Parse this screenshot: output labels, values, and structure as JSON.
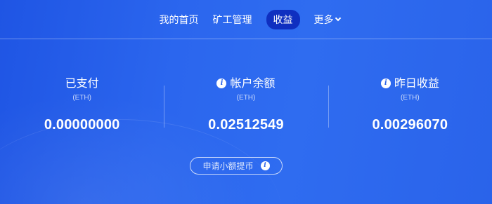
{
  "nav": {
    "items": [
      {
        "label": "我的首页"
      },
      {
        "label": "矿工管理"
      },
      {
        "label": "收益",
        "active": true
      },
      {
        "label": "更多",
        "dropdown": true
      }
    ]
  },
  "stats": [
    {
      "title": "已支付",
      "unit": "(ETH)",
      "value": "0.00000000",
      "has_info_icon": false
    },
    {
      "title": "帐户余额",
      "unit": "(ETH)",
      "value": "0.02512549",
      "has_info_icon": true
    },
    {
      "title": "昨日收益",
      "unit": "(ETH)",
      "value": "0.00296070",
      "has_info_icon": true
    }
  ],
  "withdraw": {
    "label": "申请小额提币",
    "icon": "info-icon"
  },
  "colors": {
    "background": "#2a63ea",
    "active_tab": "#0f2fc0",
    "text": "#ffffff"
  }
}
